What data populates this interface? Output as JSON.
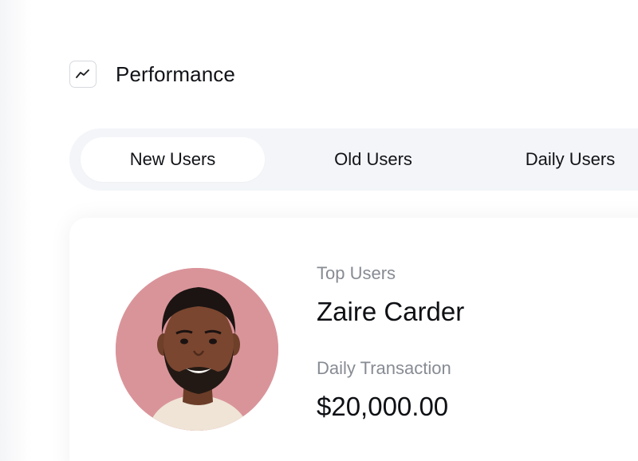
{
  "header": {
    "icon": "trend-line-icon",
    "title": "Performance"
  },
  "tabs": [
    {
      "label": "New Users",
      "active": true
    },
    {
      "label": "Old Users",
      "active": false
    },
    {
      "label": "Daily Users",
      "active": false
    }
  ],
  "card": {
    "avatar_bg": "#d9949a",
    "top_users_label": "Top Users",
    "user_name": "Zaire Carder",
    "daily_transaction_label": "Daily Transaction",
    "amount": "$20,000.00"
  }
}
